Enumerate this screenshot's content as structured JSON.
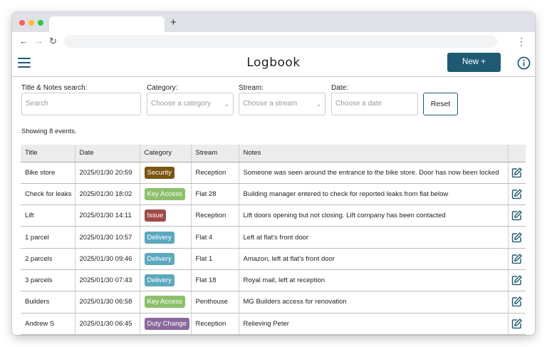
{
  "app": {
    "title": "Logbook",
    "new_button": "New +"
  },
  "browser": {
    "new_tab_glyph": "+"
  },
  "filters": {
    "title_search": {
      "label": "Title & Notes search:",
      "placeholder": "Search"
    },
    "category": {
      "label": "Category:",
      "placeholder": "Choose a category"
    },
    "stream": {
      "label": "Stream:",
      "placeholder": "Choose a stream"
    },
    "date": {
      "label": "Date:",
      "placeholder": "Choose a date"
    },
    "reset_label": "Reset"
  },
  "showing_text": "Showing 8 events.",
  "table": {
    "headers": [
      "Title",
      "Date",
      "Category",
      "Stream",
      "Notes",
      ""
    ],
    "rows": [
      {
        "title": "Bike store",
        "date": "2025/01/30 20:59",
        "category": "Security",
        "stream": "Reception",
        "notes": "Someone was seen around the entrance to the bike store. Door has now been locked"
      },
      {
        "title": "Check for leaks",
        "date": "2025/01/30 18:02",
        "category": "Key Access",
        "stream": "Flat 28",
        "notes": "Building manager entered to check for reported leaks from flat below"
      },
      {
        "title": "Lift",
        "date": "2025/01/30 14:11",
        "category": "Issue",
        "stream": "Reception",
        "notes": "Lift doors opening but not closing. Lift company has been contacted"
      },
      {
        "title": "1 parcel",
        "date": "2025/01/30 10:57",
        "category": "Delivery",
        "stream": "Flat 4",
        "notes": "Left at flat's front door"
      },
      {
        "title": "2 parcels",
        "date": "2025/01/30 09:46",
        "category": "Delivery",
        "stream": "Flat 1",
        "notes": "Amazon, left at flat's front door"
      },
      {
        "title": "3 parcels",
        "date": "2025/01/30 07:43",
        "category": "Delivery",
        "stream": "Flat 18",
        "notes": "Royal mail, left at reception"
      },
      {
        "title": "Builders",
        "date": "2025/01/30 06:58",
        "category": "Key Access",
        "stream": "Penthouse",
        "notes": "MG Builders access for renovation"
      },
      {
        "title": "Andrew S",
        "date": "2025/01/30 06:45",
        "category": "Duty Change",
        "stream": "Reception",
        "notes": "Relieving Peter"
      }
    ]
  },
  "category_colors": {
    "Security": "#7a5410",
    "Key Access": "#8cc06a",
    "Issue": "#a04a4a",
    "Delivery": "#5aa9bf",
    "Duty Change": "#8a6a9e"
  },
  "colors": {
    "accent": "#1e5b73"
  },
  "icons": {
    "menu": "hamburger-menu-icon",
    "info": "info-circle-icon",
    "edit": "edit-pencil-icon"
  }
}
